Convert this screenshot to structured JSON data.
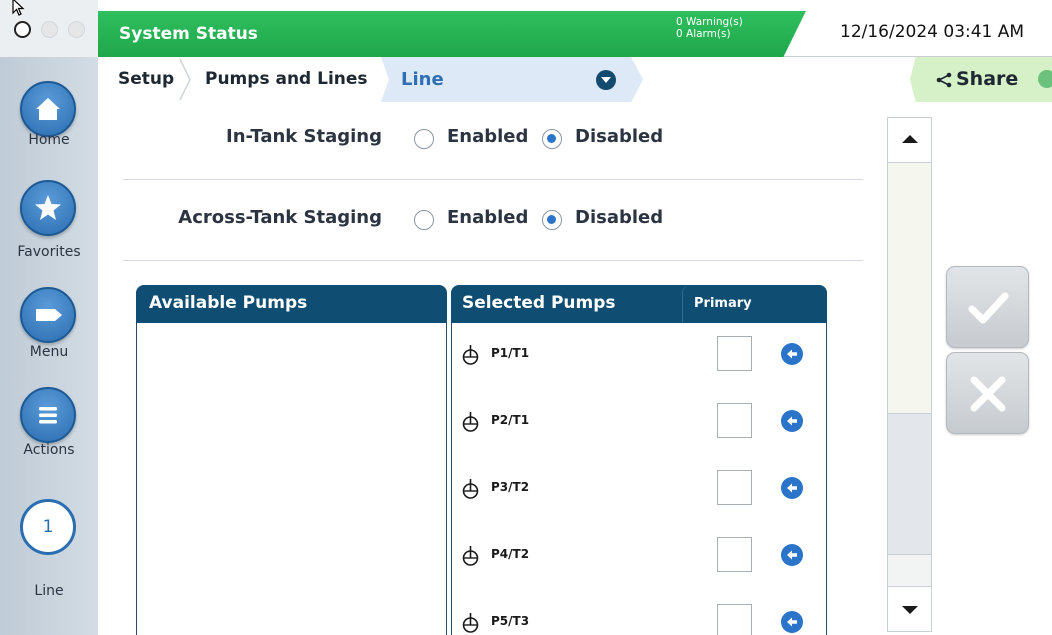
{
  "status_bar": {
    "title": "System Status",
    "warnings": "0 Warning(s)",
    "alarms": "0 Alarm(s)",
    "datetime": "12/16/2024 03:41 AM"
  },
  "breadcrumb": {
    "setup": "Setup",
    "pumps_and_lines": "Pumps and Lines",
    "current": "Line",
    "share": "Share"
  },
  "nav": {
    "home": "Home",
    "favorites": "Favorites",
    "menu": "Menu",
    "actions": "Actions",
    "line_number": "1",
    "line": "Line"
  },
  "settings": {
    "in_tank": {
      "label": "In-Tank Staging",
      "enabled": "Enabled",
      "disabled": "Disabled",
      "selected": "Disabled"
    },
    "across_tank": {
      "label": "Across-Tank Staging",
      "enabled": "Enabled",
      "disabled": "Disabled",
      "selected": "Disabled"
    }
  },
  "pumps": {
    "available_header": "Available Pumps",
    "selected_header": "Selected Pumps",
    "primary_header": "Primary",
    "available": [],
    "selected": [
      {
        "name": "P1/T1",
        "primary": false
      },
      {
        "name": "P2/T1",
        "primary": false
      },
      {
        "name": "P3/T2",
        "primary": false
      },
      {
        "name": "P4/T2",
        "primary": false
      },
      {
        "name": "P5/T3",
        "primary": false
      }
    ]
  },
  "icons": {
    "home": "home-icon",
    "favorites": "star-icon",
    "menu": "tag-icon",
    "actions": "list-icon",
    "pump": "pump-icon",
    "move_left": "arrow-left-icon",
    "share": "share-icon",
    "confirm": "check-icon",
    "cancel": "close-icon"
  },
  "colors": {
    "status_green": "#1fa74b",
    "header_navy": "#0f4d72",
    "accent_blue": "#2a74c9"
  }
}
